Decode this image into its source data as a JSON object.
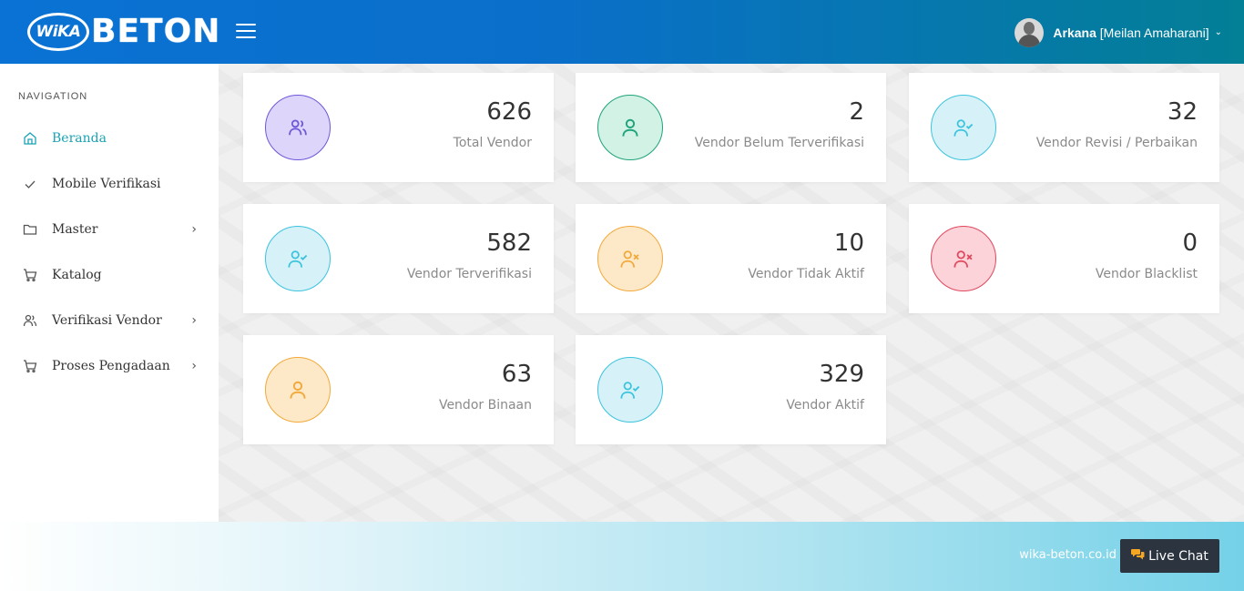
{
  "header": {
    "logo_wika": "WiKA",
    "logo_beton": "BETON",
    "user_name_bold": "Arkana",
    "user_name_rest": " [Meilan Amaharani]",
    "caret": "⌄"
  },
  "sidebar": {
    "heading": "NAVIGATION",
    "items": [
      {
        "label": "Beranda",
        "icon": "home-icon",
        "active": true,
        "has_arrow": false
      },
      {
        "label": "Mobile Verifikasi",
        "icon": "check-icon",
        "active": false,
        "has_arrow": false
      },
      {
        "label": "Master",
        "icon": "folder-icon",
        "active": false,
        "has_arrow": true
      },
      {
        "label": "Katalog",
        "icon": "cart-icon",
        "active": false,
        "has_arrow": false
      },
      {
        "label": "Verifikasi Vendor",
        "icon": "users-icon",
        "active": false,
        "has_arrow": true
      },
      {
        "label": "Proses Pengadaan",
        "icon": "cart-icon",
        "active": false,
        "has_arrow": true
      }
    ],
    "arrow": "›"
  },
  "cards": [
    {
      "value": "626",
      "label": "Total Vendor",
      "icon": "users-icon",
      "color": "#6f57d9",
      "bg": "#ddd6fa"
    },
    {
      "value": "2",
      "label": "Vendor Belum Terverifikasi",
      "icon": "user-icon",
      "color": "#1fa37a",
      "bg": "#d1f2e5"
    },
    {
      "value": "32",
      "label": "Vendor Revisi / Perbaikan",
      "icon": "user-check-icon",
      "color": "#3cc3dd",
      "bg": "#d6f2f8"
    },
    {
      "value": "582",
      "label": "Vendor Terverifikasi",
      "icon": "user-check-icon",
      "color": "#3cc3dd",
      "bg": "#d6f2f8"
    },
    {
      "value": "10",
      "label": "Vendor Tidak Aktif",
      "icon": "user-x-icon",
      "color": "#f2a93b",
      "bg": "#fde9c8"
    },
    {
      "value": "0",
      "label": "Vendor Blacklist",
      "icon": "user-x-icon",
      "color": "#e0485e",
      "bg": "#fbd3d9"
    },
    {
      "value": "63",
      "label": "Vendor Binaan",
      "icon": "user-icon",
      "color": "#f2a93b",
      "bg": "#fde9c8"
    },
    {
      "value": "329",
      "label": "Vendor Aktif",
      "icon": "user-check-icon",
      "color": "#3cc3dd",
      "bg": "#d6f2f8"
    }
  ],
  "footer": {
    "site": "wika-beton.co.id",
    "live_chat": "Live Chat",
    "chat_icon": "chat-icon"
  }
}
